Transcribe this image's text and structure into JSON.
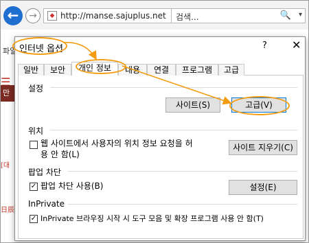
{
  "browser": {
    "back_glyph": "←",
    "forward_glyph": "→",
    "url": "http://manse.sajuplus.net",
    "search_placeholder": "검색...",
    "search_glyph": "🔍",
    "dropdown_glyph": "▾"
  },
  "page": {
    "tab_label": "파일",
    "side_red_glyph": "☰",
    "side_brown_label": "만세",
    "side_bracket_text": "[대",
    "side_bottom_text": "日辰"
  },
  "dialog": {
    "title": "인터넷 옵션",
    "help_glyph": "?",
    "close_glyph": "✕",
    "tabs": [
      "일반",
      "보안",
      "개인 정보",
      "내용",
      "연결",
      "프로그램",
      "고급"
    ],
    "active_tab": "개인 정보",
    "settings": {
      "header": "설정",
      "sites_button": "사이트(S)",
      "advanced_button": "고급(V)"
    },
    "location": {
      "header": "위치",
      "checkbox_label_line1": "웹 사이트에서 사용자의 위치 정보 요청을 허",
      "checkbox_label_line2": "용 안 함(L)",
      "checked": false,
      "clear_sites_button": "사이트 지우기(C)"
    },
    "popup": {
      "header": "팝업 차단",
      "checkbox_label": "팝업 차단 사용(B)",
      "checked": true,
      "settings_button": "설정(E)"
    },
    "inprivate": {
      "header": "InPrivate",
      "checkbox_label": "InPrivate 브라우징 시작 시 도구 모음 및 확장 프로그램 사용 안 함(T)",
      "checked": true
    },
    "check_glyph": "✓"
  },
  "colors": {
    "annotation": "#f39c12",
    "nav_blue": "#1f6fd1",
    "side_brown": "#7b2a22"
  }
}
